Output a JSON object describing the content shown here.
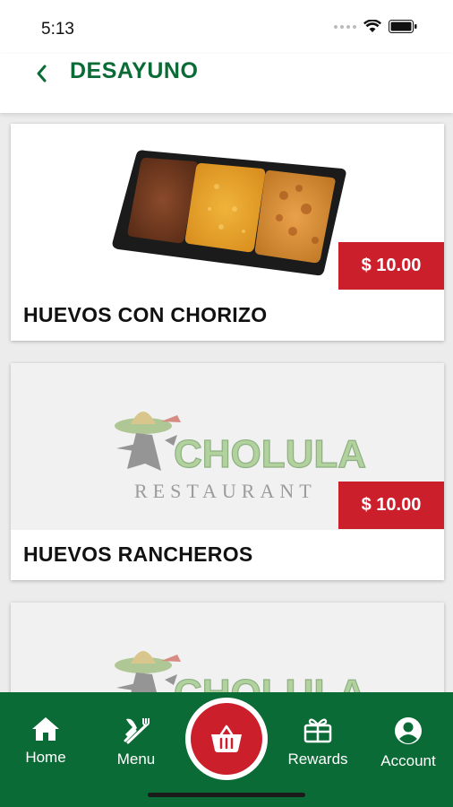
{
  "status_bar": {
    "time": "5:13"
  },
  "header": {
    "title": "DESAYUNO"
  },
  "items": [
    {
      "name": "HUEVOS CON CHORIZO",
      "price": "$ 10.00"
    },
    {
      "name": "HUEVOS RANCHEROS",
      "price": "$ 10.00"
    },
    {
      "name": "",
      "price": ""
    }
  ],
  "logo": {
    "wordmark": "CHOLULA",
    "subtitle": "RESTAURANT"
  },
  "bottom_nav": {
    "items": [
      {
        "label": "Home",
        "icon": "home-icon"
      },
      {
        "label": "Menu",
        "icon": "utensils-icon"
      },
      {
        "label": "Rewards",
        "icon": "gift-icon"
      },
      {
        "label": "Account",
        "icon": "account-icon"
      }
    ],
    "cart_icon": "basket-icon"
  },
  "colors": {
    "brand_green": "#0b6b36",
    "price_red": "#cc1f2c"
  }
}
